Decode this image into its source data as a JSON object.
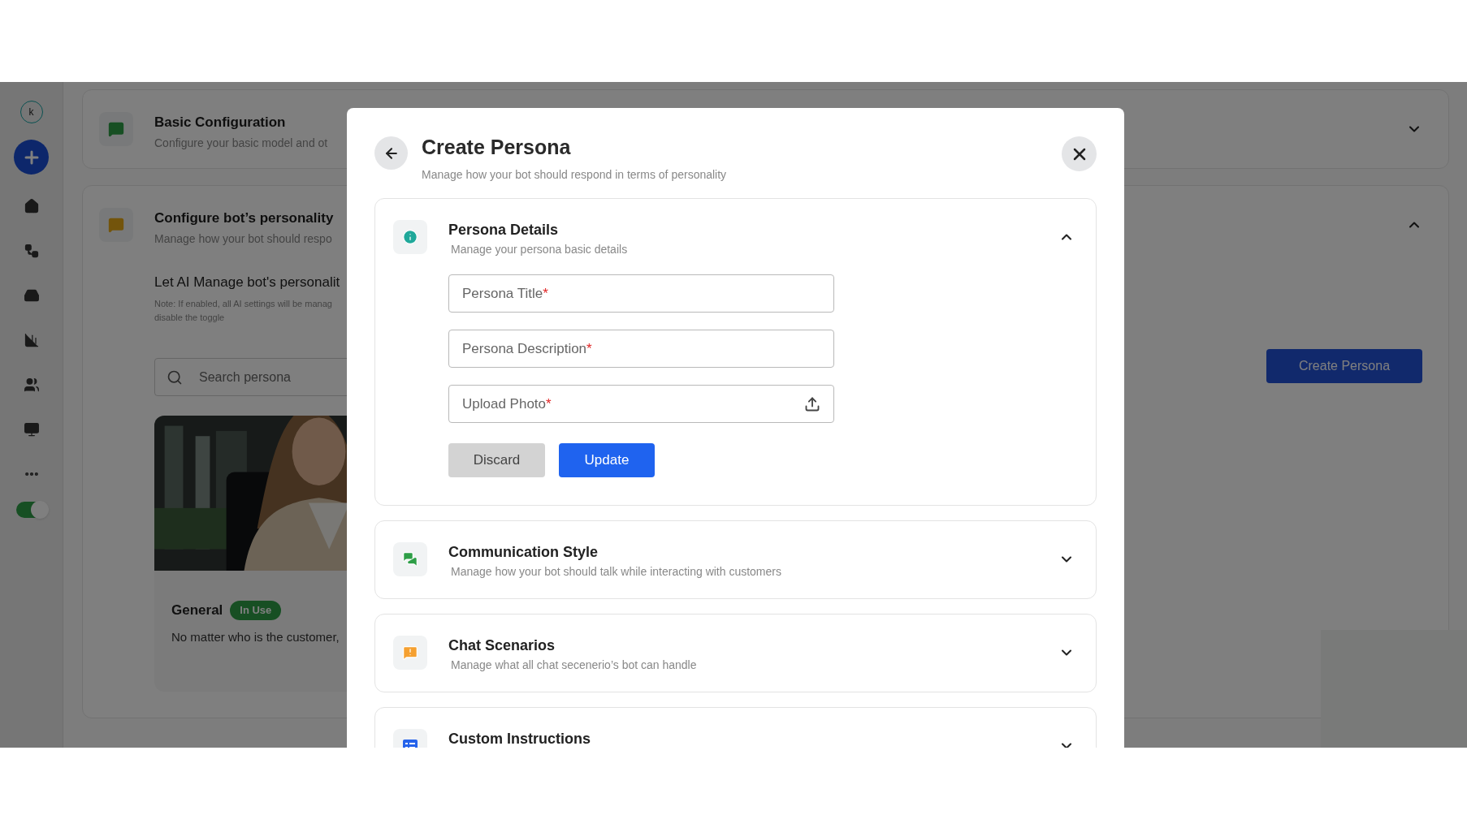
{
  "sidebar": {
    "logo_letter": "k",
    "toggle_on": true
  },
  "background": {
    "cards": [
      {
        "title": "Basic Configuration",
        "subtitle": "Configure your basic model and ot",
        "expanded": false
      },
      {
        "title": "Configure bot’s personality",
        "subtitle": "Manage how your bot should respo",
        "expanded": true
      }
    ],
    "ai_toggle_title": "Let AI Manage bot's personalit",
    "note_lines": [
      "Note: If enabled, all AI settings will be manag",
      "disable the toggle"
    ],
    "search": {
      "placeholder": "Search persona"
    },
    "persona_card": {
      "kind": "picture",
      "name": "General",
      "badge": "In Use",
      "description": "No matter who is the customer,"
    },
    "create_button": "Create Persona"
  },
  "modal": {
    "title": "Create Persona",
    "subtitle": "Manage how your bot should respond in terms of personality",
    "sections": [
      {
        "title": "Persona Details",
        "subtitle": "Manage your persona basic details",
        "expanded": true,
        "color": "#1fa89a",
        "fields": [
          {
            "kind": "text",
            "label": "Persona Title",
            "required_mark": "*"
          },
          {
            "kind": "text",
            "label": "Persona Description",
            "required_mark": "*"
          },
          {
            "kind": "upload",
            "label": "Upload Photo",
            "required_mark": "*"
          }
        ],
        "buttons": [
          "Discard",
          "Update"
        ]
      },
      {
        "title": "Communication Style",
        "subtitle": "Manage how your bot should talk while interacting with customers",
        "expanded": false,
        "color": "#2e9e47"
      },
      {
        "title": "Chat Scenarios",
        "subtitle": "Manage what all chat secenerio’s bot can handle",
        "expanded": false,
        "color": "#f5a030"
      },
      {
        "title": "Custom Instructions",
        "expanded": false,
        "color": "#2563eb"
      }
    ]
  }
}
